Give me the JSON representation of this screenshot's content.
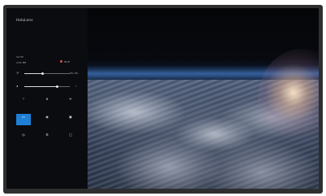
{
  "app": {
    "brand": "HoloLens"
  },
  "status": {
    "time": "12:33",
    "battery_text": "4:31 PM",
    "wifi_label": "Wi-Fi",
    "vol_value": "0% 0%"
  },
  "tiles": [
    {
      "icon": "wifi-icon",
      "glyph": "⌔",
      "label": ""
    },
    {
      "icon": "bluetooth-icon",
      "glyph": "ʙ",
      "label": ""
    },
    {
      "icon": "airplane-icon",
      "glyph": "✈",
      "label": ""
    },
    {
      "icon": "display-icon",
      "glyph": "▭",
      "label": ""
    },
    {
      "icon": "camera-icon",
      "glyph": "◉",
      "label": ""
    },
    {
      "icon": "projector-icon",
      "glyph": "▣",
      "label": ""
    },
    {
      "icon": "location-icon",
      "glyph": "◎",
      "label": ""
    },
    {
      "icon": "settings-icon",
      "glyph": "⚙",
      "label": ""
    },
    {
      "icon": "cast-icon",
      "glyph": "▢",
      "label": ""
    }
  ],
  "colors": {
    "accent": "#1e7fd6",
    "panel": "#0b0c0f",
    "notification_dot": "#e05050"
  }
}
